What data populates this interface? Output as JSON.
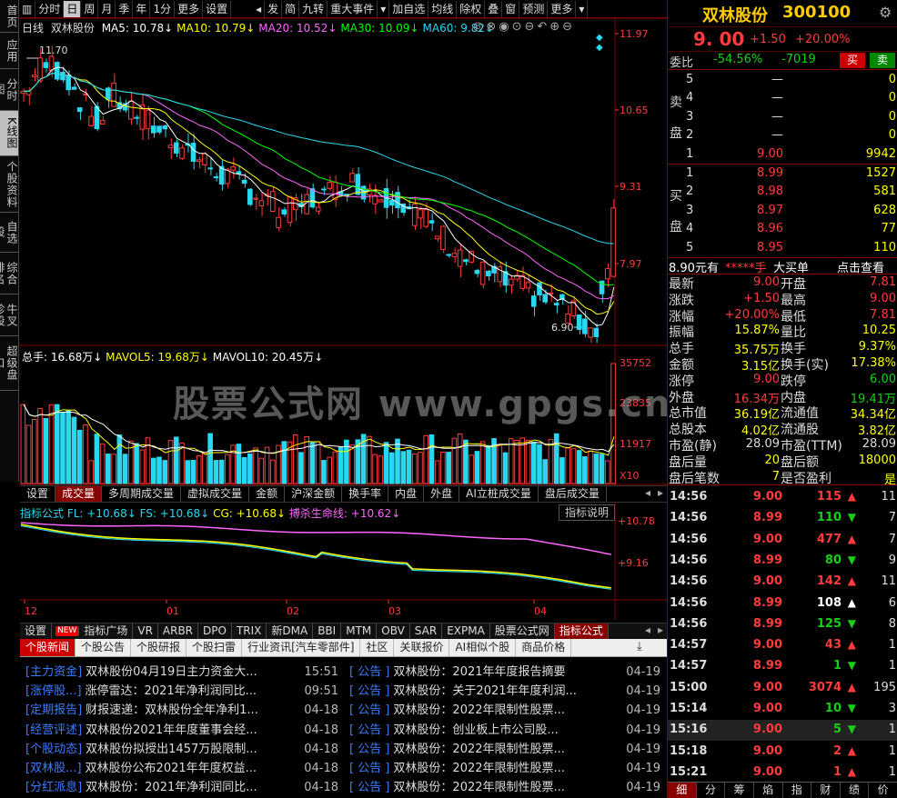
{
  "left_tabs": [
    {
      "label": "首页"
    },
    {
      "label": "应用"
    },
    {
      "label": "分时图"
    },
    {
      "label": "K线图"
    },
    {
      "label": "个股资料"
    },
    {
      "label": "自选股"
    },
    {
      "label": "综合排名"
    },
    {
      "label": "牛叉诊股"
    },
    {
      "label": "超级盘口"
    }
  ],
  "toolbar": {
    "items": [
      "分时",
      "日",
      "周",
      "月",
      "季",
      "年",
      "1分",
      "更多",
      "设置"
    ],
    "items2": [
      "发",
      "简",
      "九转",
      "重大事件"
    ],
    "items3": [
      "加自选",
      "均线",
      "除权",
      "叠",
      "窗",
      "预测",
      "更多"
    ]
  },
  "chart": {
    "period": "日线",
    "stock_name": "双林股份",
    "ma": [
      {
        "label": "MA5: 10.78",
        "color": "#ffffff"
      },
      {
        "label": "MA10: 10.79",
        "color": "#ffff00"
      },
      {
        "label": "MA20: 10.52",
        "color": "#ff66ff"
      },
      {
        "label": "MA30: 10.09",
        "color": "#00ff00"
      },
      {
        "label": "MA60: 9.82",
        "color": "#28d8f0"
      }
    ],
    "price_ticks": [
      "11.97",
      "10.65",
      "9.31",
      "7.97"
    ],
    "high_label": "11.70",
    "low_label": "6.90",
    "vol_header": {
      "total": "总手: 16.68万",
      "mavol5": "MAVOL5: 19.68万",
      "mavol10": "MAVOL10: 20.45万"
    },
    "vol_ticks": [
      "35752",
      "23835",
      "11917",
      "X10"
    ],
    "vol_tabs": [
      "设置",
      "成交量",
      "多周期成交量",
      "虚拟成交量",
      "金额",
      "沪深金额",
      "换手率",
      "内盘",
      "外盘",
      "AI立桩成交量",
      "盘后成交量"
    ],
    "ind_header": {
      "title": "指标公式",
      "fl": "FL: +10.68",
      "fs": "FS: +10.68",
      "cg": "CG: +10.68",
      "bs": "搏杀生命线: +10.62"
    },
    "ind_ticks": [
      "+10.78",
      "+9.16"
    ],
    "ind_help": "指标说明",
    "months": [
      "12",
      "01",
      "02",
      "03",
      "04"
    ],
    "ind_tabs": [
      "设置",
      "NEW",
      "指标广场",
      "VR",
      "ARBR",
      "DPO",
      "TRIX",
      "新DMA",
      "BBI",
      "MTM",
      "OBV",
      "SAR",
      "EXPMA",
      "股票公式网",
      "指标公式"
    ]
  },
  "watermark": "股票公式网 www.gpgs.cn",
  "news": {
    "tabs": [
      "个股新闻",
      "个股公告",
      "个股研报",
      "个股扫雷",
      "行业资讯[汽车零部件]",
      "社区",
      "关联报价",
      "AI相似个股",
      "商品价格"
    ],
    "left": [
      {
        "tag": "[主力资金]",
        "title": "双林股份04月19日主力资金大...",
        "time": "15:51"
      },
      {
        "tag": "[涨停股...]",
        "title": "涨停雷达：2021年净利润同比...",
        "time": "09:51"
      },
      {
        "tag": "[定期报告]",
        "title": "财报速递：双林股份全年净利1...",
        "time": "04-18"
      },
      {
        "tag": "[经营评述]",
        "title": "双林股份2021年年度董事会经...",
        "time": "04-18"
      },
      {
        "tag": "[个股动态]",
        "title": "双林股份拟授出1457万股限制...",
        "time": "04-18"
      },
      {
        "tag": "[双林股...]",
        "title": "双林股份公布2021年年度权益...",
        "time": "04-18"
      },
      {
        "tag": "[分红派息]",
        "title": "双林股份：2021年净利润同比...",
        "time": "04-18"
      }
    ],
    "right": [
      {
        "tag": "[ 公告 ]",
        "title": "双林股份：2021年年度报告摘要",
        "time": "04-19"
      },
      {
        "tag": "[ 公告 ]",
        "title": "双林股份：关于2021年年度利润...",
        "time": "04-19"
      },
      {
        "tag": "[ 公告 ]",
        "title": "双林股份：2022年限制性股票...",
        "time": "04-19"
      },
      {
        "tag": "[ 公告 ]",
        "title": "双林股份：创业板上市公司股...",
        "time": "04-19"
      },
      {
        "tag": "[ 公告 ]",
        "title": "双林股份：2022年限制性股票...",
        "time": "04-19"
      },
      {
        "tag": "[ 公告 ]",
        "title": "双林股份：2022年限制性股票...",
        "time": "04-19"
      },
      {
        "tag": "[ 公告 ]",
        "title": "双林股份：2022年限制性股票...",
        "time": "04-19"
      }
    ]
  },
  "quote": {
    "name": "双林股份",
    "code": "300100",
    "price": "9. 00",
    "change": "+1.50",
    "pct": "+20.00%",
    "webi_label": "委比",
    "webi": "-54.56%",
    "wecha": "-7019",
    "buy": "买",
    "sell": "卖",
    "sell_label": "卖盘",
    "buy_label": "买盘",
    "asks": [
      {
        "n": "5",
        "p": "—",
        "v": "0"
      },
      {
        "n": "4",
        "p": "—",
        "v": "0"
      },
      {
        "n": "3",
        "p": "—",
        "v": "0"
      },
      {
        "n": "2",
        "p": "—",
        "v": "0"
      },
      {
        "n": "1",
        "p": "9.00",
        "v": "9942"
      }
    ],
    "bids": [
      {
        "n": "1",
        "p": "8.99",
        "v": "1527"
      },
      {
        "n": "2",
        "p": "8.98",
        "v": "581"
      },
      {
        "n": "3",
        "p": "8.97",
        "v": "628"
      },
      {
        "n": "4",
        "p": "8.96",
        "v": "77"
      },
      {
        "n": "5",
        "p": "8.95",
        "v": "110"
      }
    ],
    "bigorder": {
      "a": "8.90元有",
      "b": "*****手",
      "c": "大买单",
      "d": "点击查看"
    },
    "stats": [
      [
        "最新",
        "9.00",
        "开盘",
        "7.81"
      ],
      [
        "涨跌",
        "+1.50",
        "最高",
        "9.00"
      ],
      [
        "涨幅",
        "+20.00%",
        "最低",
        "7.81"
      ],
      [
        "振幅",
        "15.87%",
        "量比",
        "10.25"
      ],
      [
        "总手",
        "35.75万",
        "换手",
        "9.37%"
      ],
      [
        "金额",
        "3.15亿",
        "换手(实)",
        "17.38%"
      ],
      [
        "涨停",
        "9.00",
        "跌停",
        "6.00"
      ],
      [
        "外盘",
        "16.34万",
        "内盘",
        "19.41万"
      ],
      [
        "总市值",
        "36.19亿",
        "流通值",
        "34.34亿"
      ],
      [
        "总股本",
        "4.02亿",
        "流通股",
        "3.82亿"
      ],
      [
        "市盈(静)",
        "28.09",
        "市盈(TTM)",
        "28.09"
      ],
      [
        "盘后量",
        "20",
        "盘后额",
        "18000"
      ],
      [
        "盘后笔数",
        "7",
        "是否盈利",
        "是"
      ]
    ],
    "ticks": [
      {
        "t": "14:56",
        "p": "9.00",
        "v": "115",
        "d": "up",
        "n": "11"
      },
      {
        "t": "14:56",
        "p": "8.99",
        "v": "110",
        "d": "down",
        "n": "7"
      },
      {
        "t": "14:56",
        "p": "9.00",
        "v": "477",
        "d": "up",
        "n": "7"
      },
      {
        "t": "14:56",
        "p": "8.99",
        "v": "80",
        "d": "down",
        "n": "9"
      },
      {
        "t": "14:56",
        "p": "9.00",
        "v": "142",
        "d": "up",
        "n": "11"
      },
      {
        "t": "14:56",
        "p": "8.99",
        "v": "108",
        "d": "flat",
        "n": "6"
      },
      {
        "t": "14:56",
        "p": "8.99",
        "v": "125",
        "d": "down",
        "n": "8"
      },
      {
        "t": "14:57",
        "p": "9.00",
        "v": "43",
        "d": "up",
        "n": "1"
      },
      {
        "t": "14:57",
        "p": "8.99",
        "v": "1",
        "d": "down",
        "n": "1"
      },
      {
        "t": "15:00",
        "p": "9.00",
        "v": "3074",
        "d": "up",
        "n": "195"
      },
      {
        "t": "15:14",
        "p": "9.00",
        "v": "10",
        "d": "down",
        "n": "3"
      },
      {
        "t": "15:16",
        "p": "9.00",
        "v": "5",
        "d": "down",
        "n": "1"
      },
      {
        "t": "15:18",
        "p": "9.00",
        "v": "2",
        "d": "up",
        "n": "1"
      },
      {
        "t": "15:21",
        "p": "9.00",
        "v": "1",
        "d": "up",
        "n": "1"
      }
    ],
    "bottom_tabs": [
      "细",
      "分",
      "筹",
      "焰",
      "指",
      "财",
      "绩",
      "价"
    ]
  }
}
